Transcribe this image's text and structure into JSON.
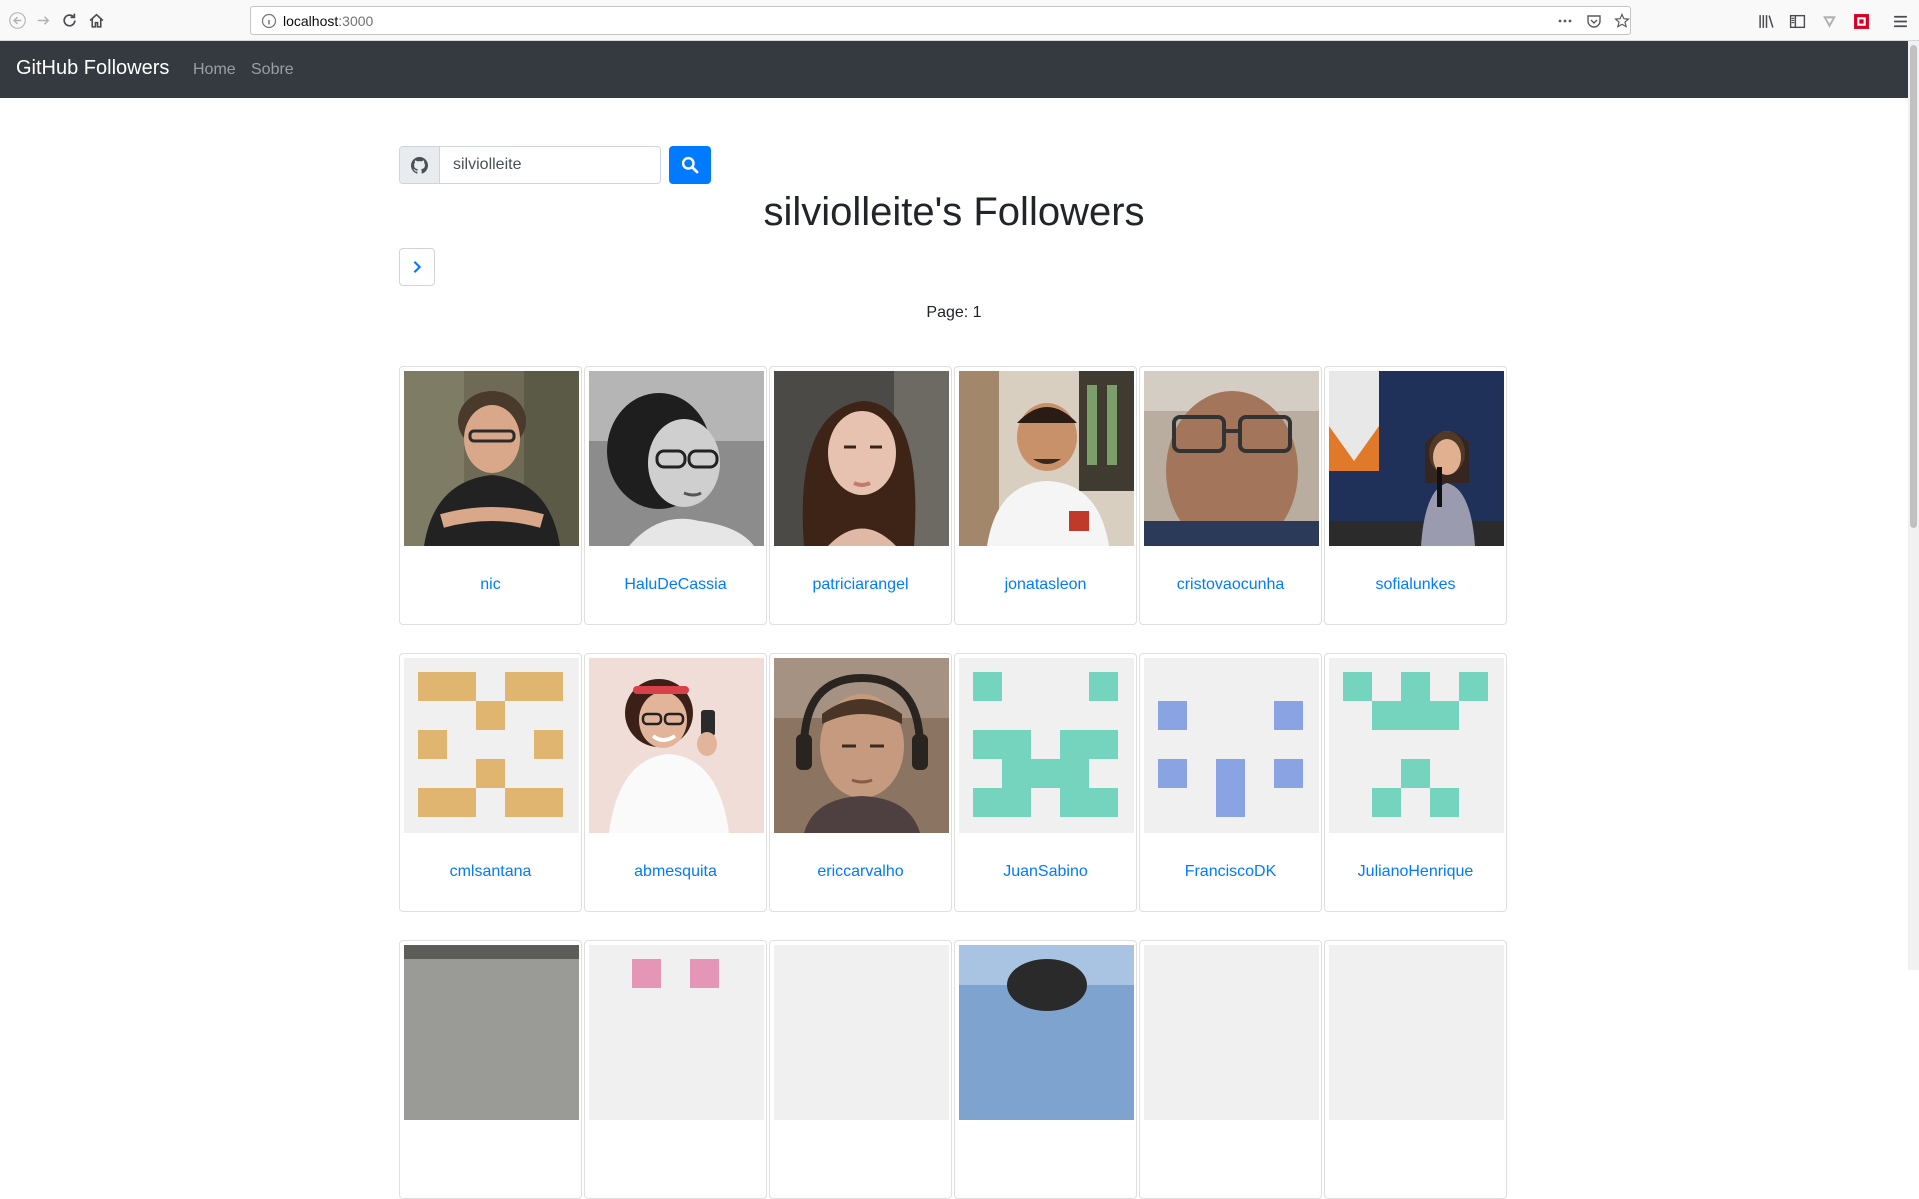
{
  "browser": {
    "url_host": "localhost",
    "url_port": ":3000"
  },
  "navbar": {
    "brand": "GitHub Followers",
    "links": [
      "Home",
      "Sobre"
    ]
  },
  "search": {
    "value": "silviolleite"
  },
  "page_title": "silviolleite's Followers",
  "page_indicator": "Page: 1",
  "followers": [
    {
      "login": "nic",
      "avatar": "photo"
    },
    {
      "login": "HaluDeCassia",
      "avatar": "photo"
    },
    {
      "login": "patriciarangel",
      "avatar": "photo"
    },
    {
      "login": "jonatasleon",
      "avatar": "photo"
    },
    {
      "login": "cristovaocunha",
      "avatar": "photo"
    },
    {
      "login": "sofialunkes",
      "avatar": "photo"
    },
    {
      "login": "cmlsantana",
      "avatar": "identicon",
      "color": "#e0b570"
    },
    {
      "login": "abmesquita",
      "avatar": "photo"
    },
    {
      "login": "ericcarvalho",
      "avatar": "photo"
    },
    {
      "login": "JuanSabino",
      "avatar": "identicon",
      "color": "#75d4bd"
    },
    {
      "login": "FranciscoDK",
      "avatar": "identicon",
      "color": "#8aa3e2"
    },
    {
      "login": "JulianoHenrique",
      "avatar": "identicon",
      "color": "#75d4bd"
    },
    {
      "login": "",
      "avatar": "photo"
    },
    {
      "login": "",
      "avatar": "identicon",
      "color": "#e596b6"
    },
    {
      "login": "",
      "avatar": "identicon",
      "color": "#f0f0f0"
    },
    {
      "login": "",
      "avatar": "photo"
    },
    {
      "login": "",
      "avatar": "identicon",
      "color": "#f0f0f0"
    },
    {
      "login": "",
      "avatar": "identicon",
      "color": "#f0f0f0"
    }
  ],
  "colors": {
    "navbar_bg": "#343a40",
    "primary": "#007bff",
    "link": "#007bff",
    "text": "#212529"
  },
  "icons": [
    "back-arrow-icon",
    "forward-arrow-icon",
    "reload-icon",
    "home-icon",
    "info-icon",
    "more-dots-icon",
    "pocket-icon",
    "bookmark-star-icon",
    "library-icon",
    "sidebar-icon",
    "vpn-icon",
    "extension-icon",
    "menu-icon",
    "github-icon",
    "search-icon",
    "chevron-right-icon"
  ]
}
